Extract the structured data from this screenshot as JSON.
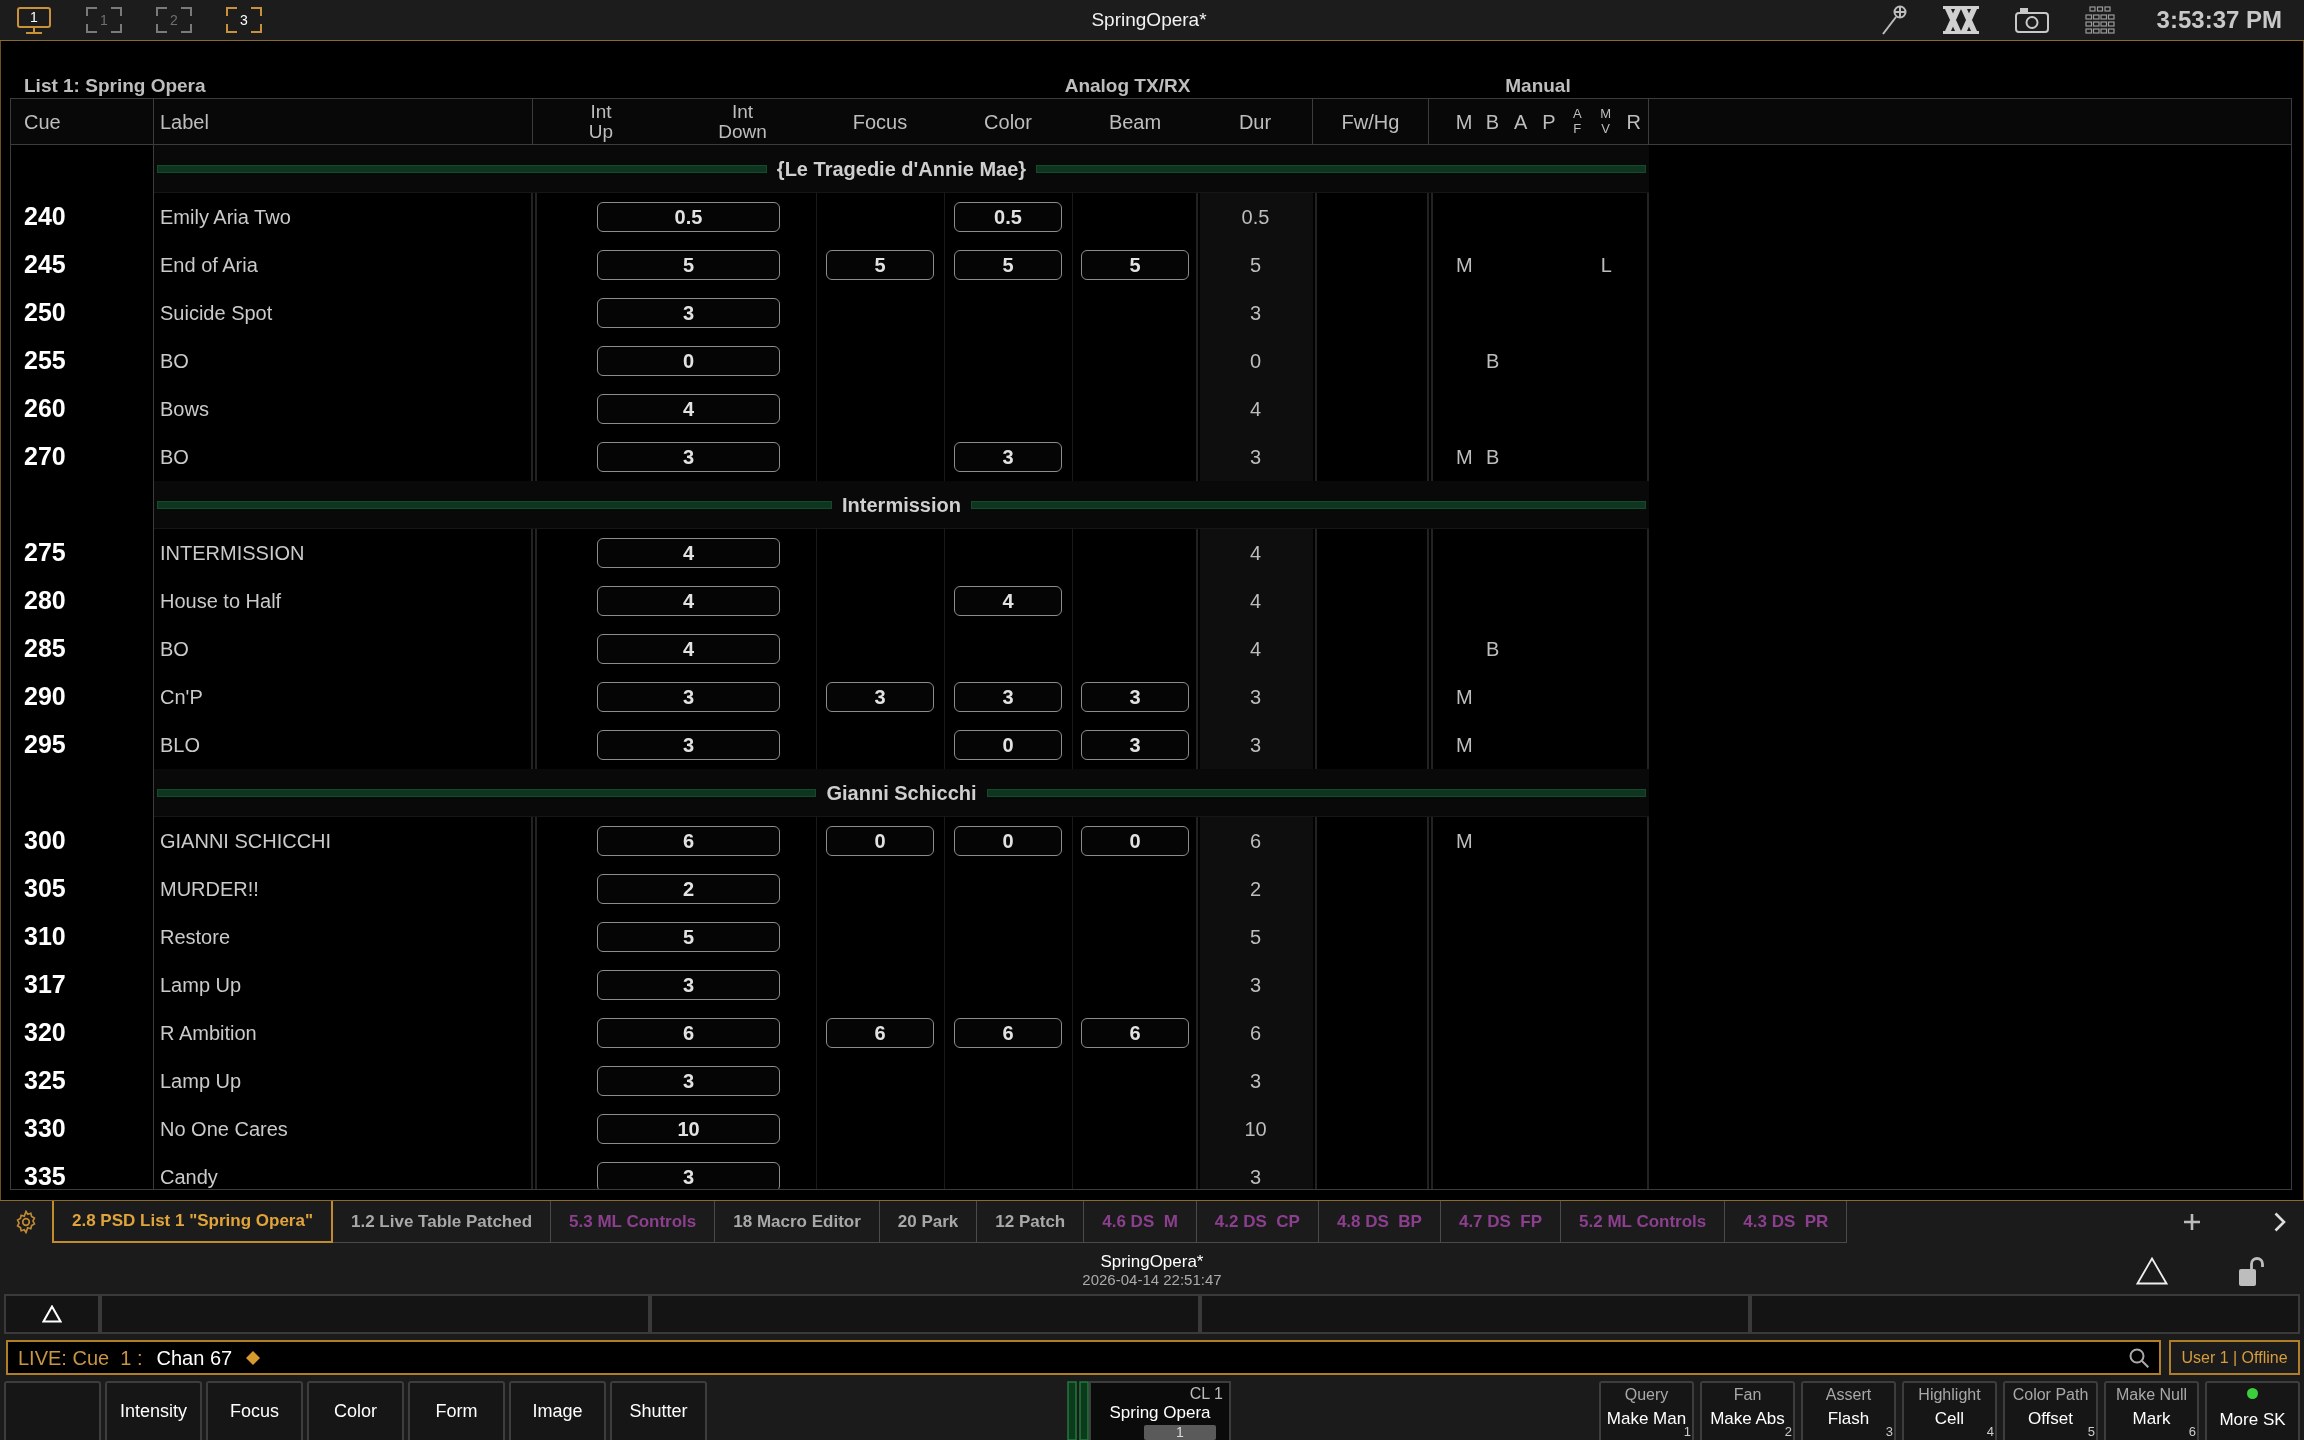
{
  "top_bar": {
    "screens": [
      {
        "kind": "monitor",
        "label": "1",
        "active": true
      },
      {
        "kind": "frame",
        "label": "1",
        "active": false
      },
      {
        "kind": "frame",
        "label": "2",
        "active": false
      },
      {
        "kind": "frame",
        "label": "3",
        "active": true
      }
    ],
    "title": "SpringOpera*",
    "clock": "3:53:37 PM"
  },
  "list": {
    "title": "List 1: Spring Opera",
    "column_groups": [
      {
        "kind": "analog",
        "label": "Analog TX/RX"
      },
      {
        "kind": "manual",
        "label": "Manual"
      }
    ],
    "columns": [
      "Cue",
      "Label",
      "Int Up",
      "Int Down",
      "Focus",
      "Color",
      "Beam",
      "Dur",
      "Fw/Hg"
    ],
    "flag_columns": [
      "M",
      "B",
      "A",
      "P",
      "AF",
      "MV",
      "R"
    ],
    "parts": [
      {
        "title": "{Le Tragedie d'Annie Mae}",
        "cues": [
          {
            "cue": "240",
            "label": "Emily Aria Two",
            "int_up": "0.5",
            "color_time": "0.5",
            "dur": "0.5"
          },
          {
            "cue": "245",
            "label": "End of Aria",
            "int_up": "5",
            "focus_time": "5",
            "color_time": "5",
            "beam_time": "5",
            "dur": "5",
            "flags": {
              "m": "M",
              "mv": "L"
            }
          },
          {
            "cue": "250",
            "label": "Suicide Spot",
            "int_up": "3",
            "dur": "3"
          },
          {
            "cue": "255",
            "label": "BO",
            "int_up": "0",
            "dur": "0",
            "flags": {
              "b": "B"
            }
          },
          {
            "cue": "260",
            "label": "Bows",
            "int_up": "4",
            "dur": "4"
          },
          {
            "cue": "270",
            "label": "BO",
            "int_up": "3",
            "color_time": "3",
            "dur": "3",
            "flags": {
              "m": "M",
              "b": "B"
            }
          }
        ]
      },
      {
        "title": "Intermission",
        "cues": [
          {
            "cue": "275",
            "label": "INTERMISSION",
            "int_up": "4",
            "dur": "4"
          },
          {
            "cue": "280",
            "label": "House to Half",
            "int_up": "4",
            "color_time": "4",
            "dur": "4"
          },
          {
            "cue": "285",
            "label": "BO",
            "int_up": "4",
            "dur": "4",
            "flags": {
              "b": "B"
            }
          },
          {
            "cue": "290",
            "label": "Cn'P",
            "int_up": "3",
            "focus_time": "3",
            "color_time": "3",
            "beam_time": "3",
            "dur": "3",
            "flags": {
              "m": "M"
            }
          },
          {
            "cue": "295",
            "label": "BLO",
            "int_up": "3",
            "color_time": "0",
            "beam_time": "3",
            "dur": "3",
            "flags": {
              "m": "M"
            }
          }
        ]
      },
      {
        "title": "Gianni Schicchi",
        "cues": [
          {
            "cue": "300",
            "label": "GIANNI SCHICCHI",
            "int_up": "6",
            "focus_time": "0",
            "color_time": "0",
            "beam_time": "0",
            "dur": "6",
            "flags": {
              "m": "M"
            }
          },
          {
            "cue": "305",
            "label": "MURDER!!",
            "int_up": "2",
            "dur": "2"
          },
          {
            "cue": "310",
            "label": "Restore",
            "int_up": "5",
            "dur": "5"
          },
          {
            "cue": "317",
            "label": "Lamp Up",
            "int_up": "3",
            "dur": "3"
          },
          {
            "cue": "320",
            "label": "R Ambition",
            "int_up": "6",
            "focus_time": "6",
            "color_time": "6",
            "beam_time": "6",
            "dur": "6"
          },
          {
            "cue": "325",
            "label": "Lamp Up",
            "int_up": "3",
            "dur": "3"
          },
          {
            "cue": "330",
            "label": "No One Cares",
            "int_up": "10",
            "dur": "10"
          },
          {
            "cue": "335",
            "label": "Candy",
            "int_up": "3",
            "dur": "3"
          }
        ]
      }
    ]
  },
  "tabs": [
    {
      "label": "2.8 PSD List 1 \"Spring Opera\"",
      "selected": true,
      "color": "#e0a43a"
    },
    {
      "label": "1.2 Live Table Patched",
      "selected": false,
      "color": "#a8a8a8"
    },
    {
      "label": "5.3 ML Controls",
      "selected": false,
      "color": "#8c3f8e"
    },
    {
      "label": "18 Macro Editor",
      "selected": false,
      "color": "#a8a8a8"
    },
    {
      "label": "20 Park",
      "selected": false,
      "color": "#a8a8a8"
    },
    {
      "label": "12 Patch",
      "selected": false,
      "color": "#a8a8a8"
    },
    {
      "label": "4.6 DS  M",
      "selected": false,
      "color": "#8c3f8e"
    },
    {
      "label": "4.2 DS  CP",
      "selected": false,
      "color": "#8c3f8e"
    },
    {
      "label": "4.8 DS  BP",
      "selected": false,
      "color": "#8c3f8e"
    },
    {
      "label": "4.7 DS  FP",
      "selected": false,
      "color": "#8c3f8e"
    },
    {
      "label": "5.2 ML Controls",
      "selected": false,
      "color": "#8c3f8e"
    },
    {
      "label": "4.3 DS  PR",
      "selected": false,
      "color": "#8c3f8e"
    }
  ],
  "show_file": {
    "name": "SpringOpera*",
    "timestamp": "2026-04-14 22:51:47"
  },
  "command_line": {
    "prefix": "LIVE: Cue  1 :",
    "command": "Chan 67"
  },
  "user_status": "User 1 | Offline",
  "parameter_buttons": [
    "Intensity",
    "Focus",
    "Color",
    "Form",
    "Image",
    "Shutter"
  ],
  "playback": {
    "list": "CL 1",
    "name": "Spring Opera",
    "cue": "1"
  },
  "softkeys": [
    {
      "shifted": "Query",
      "label": "Make Man",
      "number": "1"
    },
    {
      "shifted": "Fan",
      "label": "Make Abs",
      "number": "2"
    },
    {
      "shifted": "Assert",
      "label": "Flash",
      "number": "3"
    },
    {
      "shifted": "Highlight",
      "label": "Cell",
      "number": "4"
    },
    {
      "shifted": "Color Path",
      "label": "Offset",
      "number": "5"
    },
    {
      "shifted": "Make Null",
      "label": "Mark",
      "number": "6"
    }
  ],
  "more_softkeys": {
    "label": "More SK",
    "indicator_on": true
  }
}
